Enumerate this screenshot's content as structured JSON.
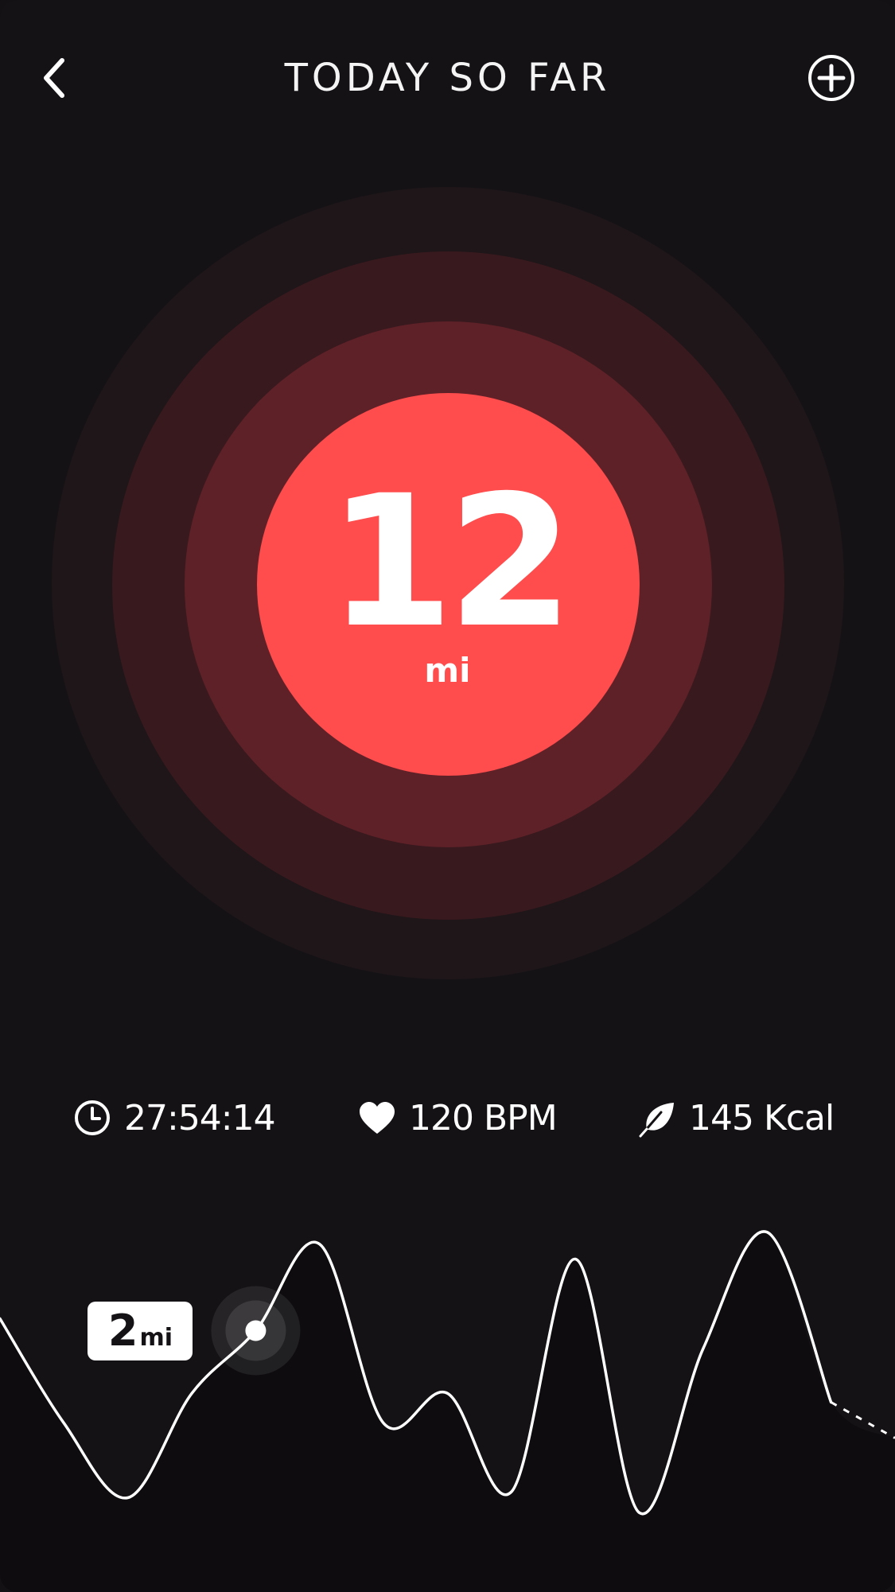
{
  "header": {
    "title": "TODAY SO FAR",
    "back_icon": "chevron-left-icon",
    "add_icon": "plus-circle-icon"
  },
  "summary": {
    "value": "12",
    "unit": "mi",
    "accent_color": "#ff4c4c"
  },
  "stats": {
    "time": {
      "icon": "clock-icon",
      "value": "27:54:14"
    },
    "heart_rate": {
      "icon": "heart-icon",
      "value": "120 BPM"
    },
    "calories": {
      "icon": "leaf-icon",
      "value": "145 Kcal"
    }
  },
  "chart_data": {
    "type": "line",
    "title": "",
    "xlabel": "",
    "ylabel": "",
    "grid": false,
    "series": [
      {
        "values": [
          0.7,
          0.35,
          0.1,
          0.45,
          0.66,
          0.95,
          0.35,
          0.45,
          0.12,
          0.9,
          0.05,
          0.6,
          0.99,
          0.42,
          0.3
        ]
      }
    ],
    "highlight": {
      "index": 4,
      "label_value": "2",
      "label_unit": "mi"
    }
  }
}
